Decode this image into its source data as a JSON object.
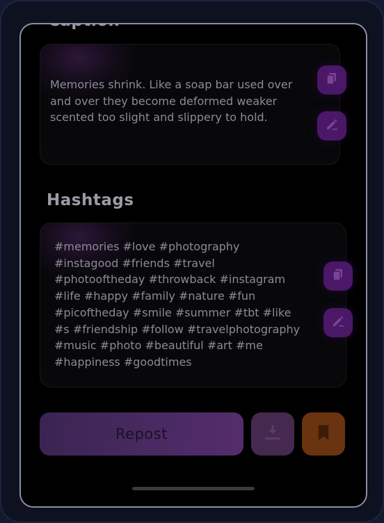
{
  "caption": {
    "title": "Caption",
    "text": "Memories shrink. Like a soap bar used over\nand over they become deformed weaker\nscented too slight and slippery to hold.",
    "copy_icon": "copy-icon",
    "edit_icon": "edit-icon"
  },
  "hashtags": {
    "title": "Hashtags",
    "text": "#memories #love #photography\n#instagood #friends #travel\n#photooftheday #throwback #instagram\n#life #happy #family #nature #fun\n#picoftheday #smile #summer #tbt #like\n#s #friendship #follow #travelphotography\n#music #photo #beautiful #art #me\n#happiness #goodtimes",
    "copy_icon": "copy-icon",
    "edit_icon": "edit-icon"
  },
  "actions": {
    "repost_label": "Repost",
    "download_icon": "download-icon",
    "bookmark_icon": "bookmark-icon"
  },
  "colors": {
    "icon_button": "#4a1866",
    "icon_glyph": "#6e3a8a",
    "repost_gradient_start": "#3a2452",
    "repost_gradient_end": "#552c6c",
    "download_button": "#45294f",
    "bookmark_button": "#6a3410",
    "text": "#8b8c94"
  }
}
